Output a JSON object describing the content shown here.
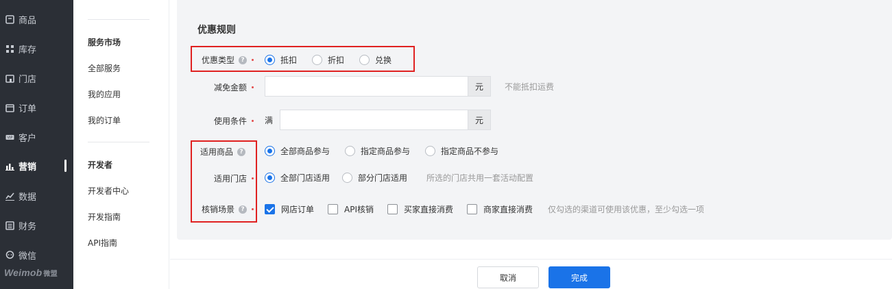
{
  "nav": {
    "items": [
      {
        "label": "商品",
        "icon": "product-icon"
      },
      {
        "label": "库存",
        "icon": "inventory-icon"
      },
      {
        "label": "门店",
        "icon": "store-icon"
      },
      {
        "label": "订单",
        "icon": "order-icon"
      },
      {
        "label": "客户",
        "icon": "customer-icon"
      },
      {
        "label": "营销",
        "icon": "marketing-icon",
        "active": true
      },
      {
        "label": "数据",
        "icon": "data-icon"
      },
      {
        "label": "财务",
        "icon": "finance-icon"
      },
      {
        "label": "微信",
        "icon": "wechat-icon"
      }
    ],
    "logo": "Weimob",
    "logo_cn": "微盟"
  },
  "subnav": {
    "section1_title": "服务市场",
    "section1_links": [
      "全部服务",
      "我的应用",
      "我的订单"
    ],
    "section2_title": "开发者",
    "section2_links": [
      "开发者中心",
      "开发指南",
      "API指南"
    ]
  },
  "form": {
    "title": "优惠规则",
    "type": {
      "label": "优惠类型",
      "options": [
        "抵扣",
        "折扣",
        "兑换"
      ],
      "selected": "抵扣"
    },
    "discount": {
      "label": "减免金额",
      "value": "",
      "unit": "元",
      "hint": "不能抵扣运费"
    },
    "condition": {
      "label": "使用条件",
      "prefix": "满",
      "value": "",
      "unit": "元"
    },
    "goods": {
      "label": "适用商品",
      "options": [
        "全部商品参与",
        "指定商品参与",
        "指定商品不参与"
      ],
      "selected": "全部商品参与"
    },
    "stores": {
      "label": "适用门店",
      "options": [
        "全部门店适用",
        "部分门店适用"
      ],
      "selected": "全部门店适用",
      "hint": "所选的门店共用一套活动配置"
    },
    "scenes": {
      "label": "核销场景",
      "options": [
        {
          "label": "网店订单",
          "checked": true
        },
        {
          "label": "API核销",
          "checked": false
        },
        {
          "label": "买家直接消费",
          "checked": false
        },
        {
          "label": "商家直接消费",
          "checked": false
        }
      ],
      "hint": "仅勾选的渠道可使用该优惠，至少勾选一项"
    }
  },
  "footer": {
    "cancel": "取消",
    "confirm": "完成"
  },
  "colors": {
    "primary": "#1a73e8",
    "nav_bg": "#2b2f36",
    "highlight_box": "#e02020"
  }
}
